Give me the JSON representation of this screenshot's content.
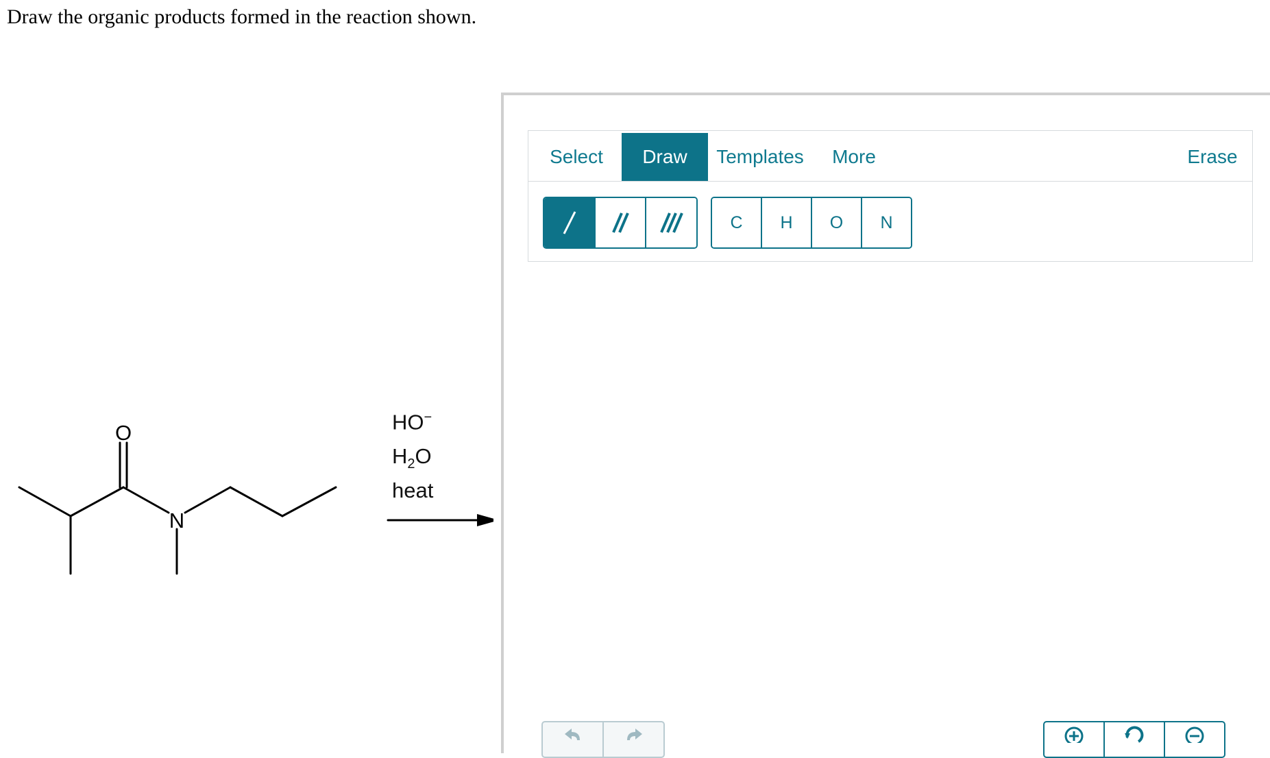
{
  "question": {
    "prompt": "Draw the organic products formed in the reaction shown."
  },
  "reaction": {
    "reactant_atoms": {
      "oxygen": "O",
      "nitrogen": "N"
    },
    "reagent_ho": "HO",
    "reagent_ho_charge": "−",
    "reagent_h2o_h": "H",
    "reagent_h2o_sub": "2",
    "reagent_h2o_o": "O",
    "condition": "heat"
  },
  "editor": {
    "tabs": {
      "select": "Select",
      "draw": "Draw",
      "templates": "Templates",
      "more": "More",
      "erase": "Erase"
    },
    "active_tab": "Draw",
    "atoms": {
      "c": "C",
      "h": "H",
      "o": "O",
      "n": "N"
    },
    "accent_color": "#0d7389"
  }
}
